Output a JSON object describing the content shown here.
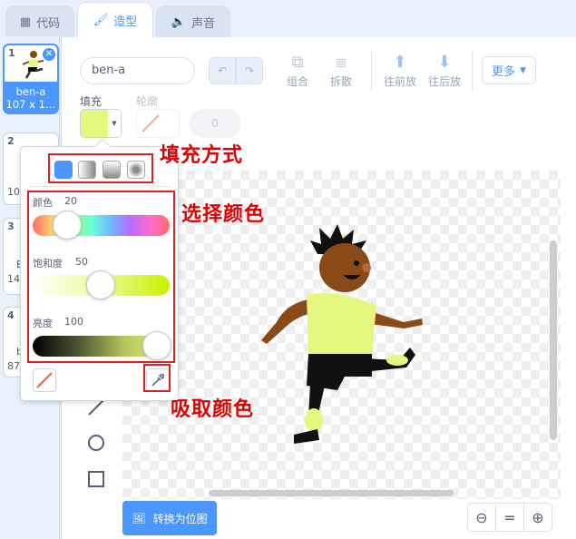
{
  "tabs": [
    {
      "label": "代码",
      "icon": "code-icon"
    },
    {
      "label": "造型",
      "icon": "brush-icon"
    },
    {
      "label": "声音",
      "icon": "speaker-icon"
    }
  ],
  "sprites": [
    {
      "num": "1",
      "name": "ben-a",
      "size": "107 x 1…"
    },
    {
      "num": "2",
      "name": "",
      "size": "10"
    },
    {
      "num": "3",
      "name": "B",
      "size": "14"
    },
    {
      "num": "4",
      "name": "b",
      "size": "87"
    }
  ],
  "costume": {
    "name": "ben-a"
  },
  "toolbar": {
    "group": "组合",
    "ungroup": "拆散",
    "forward": "往前放",
    "backward": "往后放",
    "more": "更多"
  },
  "fill": {
    "label": "填充",
    "color": "#e4f77e"
  },
  "outline": {
    "label": "轮廓",
    "width": "0"
  },
  "popup": {
    "color_label": "颜色",
    "color_value": "20",
    "saturation_label": "饱和度",
    "saturation_value": "50",
    "brightness_label": "亮度",
    "brightness_value": "100"
  },
  "annotations": {
    "fill_mode": "填充方式",
    "pick_color": "选择颜色",
    "eyedropper": "吸取颜色"
  },
  "convert_button": "转换为位图",
  "zoom": {
    "reset": "="
  }
}
